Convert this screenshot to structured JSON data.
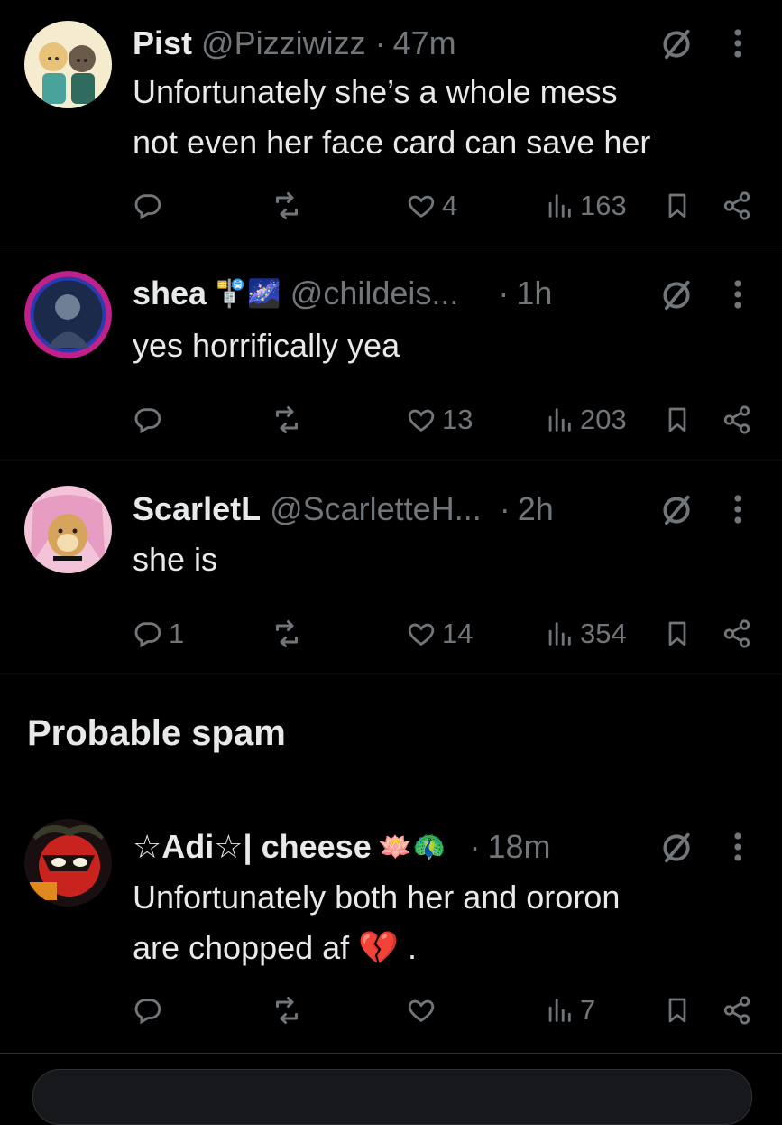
{
  "posts": [
    {
      "name": "Pist",
      "handle": "@Pizziwizz",
      "time": "47m",
      "lines": [
        "Unfortunately she’s a whole mess",
        "not even her face card can save her"
      ],
      "replies": "",
      "likes": "4",
      "views": "163"
    },
    {
      "name": "shea",
      "emojis": "🚏🌌",
      "handle": "@childeis...",
      "time": "1h",
      "lines": [
        "yes horrifically yea"
      ],
      "replies": "",
      "likes": "13",
      "views": "203"
    },
    {
      "name": "ScarletL",
      "handle": "@ScarletteH...",
      "time": "2h",
      "lines": [
        "she is"
      ],
      "replies": "1",
      "likes": "14",
      "views": "354"
    },
    {
      "name": "☆Adi☆| cheese",
      "emojis": "🪷🦚",
      "handle": "",
      "time": "18m",
      "lines": [
        "Unfortunately both her and ororon",
        "are chopped af 💔 ."
      ],
      "replies": "",
      "likes": "",
      "views": "7"
    }
  ],
  "section": {
    "probable_spam": "Probable spam"
  },
  "colors": {
    "background": "#000000",
    "text": "#e7e9ea",
    "muted": "#71767b",
    "divider": "#2f3336"
  },
  "icons": [
    "reply-icon",
    "repost-icon",
    "like-icon",
    "views-icon",
    "bookmark-icon",
    "share-icon",
    "grok-icon",
    "more-icon"
  ]
}
